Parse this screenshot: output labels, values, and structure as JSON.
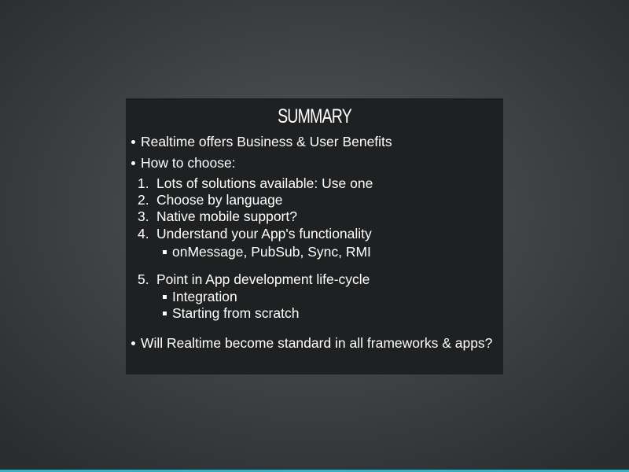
{
  "slide": {
    "title": "SUMMARY",
    "bullets": [
      "Realtime offers Business & User Benefits",
      "How to choose:",
      "Will Realtime become standard in all frameworks & apps?"
    ],
    "numbers": [
      "1.",
      "2.",
      "3.",
      "4.",
      "5."
    ],
    "steps": [
      "Lots of solutions available: Use one",
      "Choose by language",
      "Native mobile support?",
      "Understand your App's functionality",
      "Point in App development life-cycle"
    ],
    "step4_subitems": [
      "onMessage, PubSub, Sync, RMI"
    ],
    "step5_subitems": [
      "Integration",
      "Starting from scratch"
    ]
  },
  "colors": {
    "slide_background": "#1f2021",
    "text": "#ffffff",
    "accent_bar": "#2fb3c6"
  }
}
